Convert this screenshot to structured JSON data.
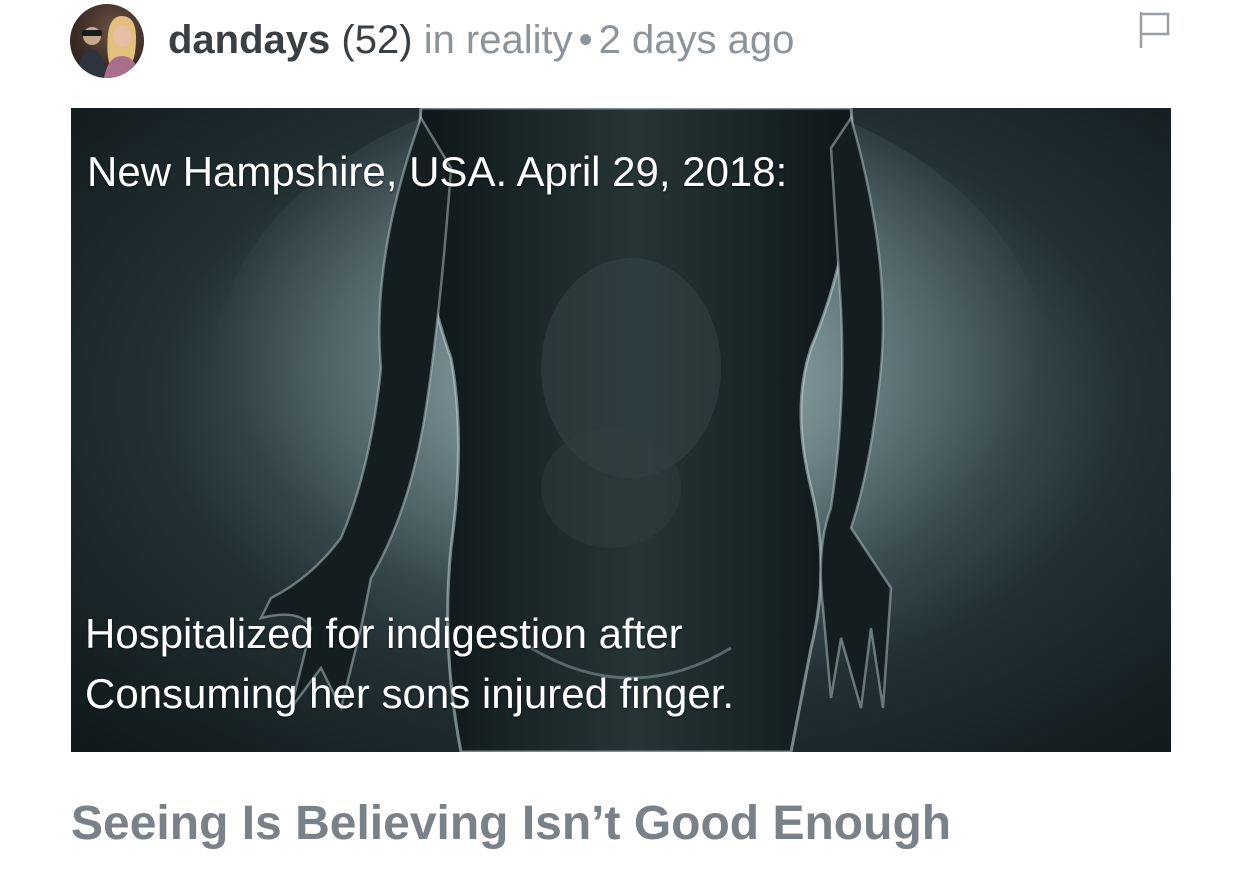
{
  "post": {
    "username": "dandays",
    "reputation": "(52)",
    "community_prefix": "in reality",
    "separator": "•",
    "timestamp": "2 days ago",
    "avatar_icon": "user-avatar",
    "flag_icon": "flag-icon",
    "image": {
      "caption_top": "New Hampshire, USA. April 29, 2018:",
      "caption_line1": "Hospitalized for indigestion after",
      "caption_line2": "Consuming her sons injured finger."
    },
    "title": "Seeing Is Believing Isn’t Good Enough"
  },
  "colors": {
    "username": "#3a3f44",
    "meta": "#8c939a",
    "title": "#7a8189",
    "image_background": "#1a2427"
  }
}
